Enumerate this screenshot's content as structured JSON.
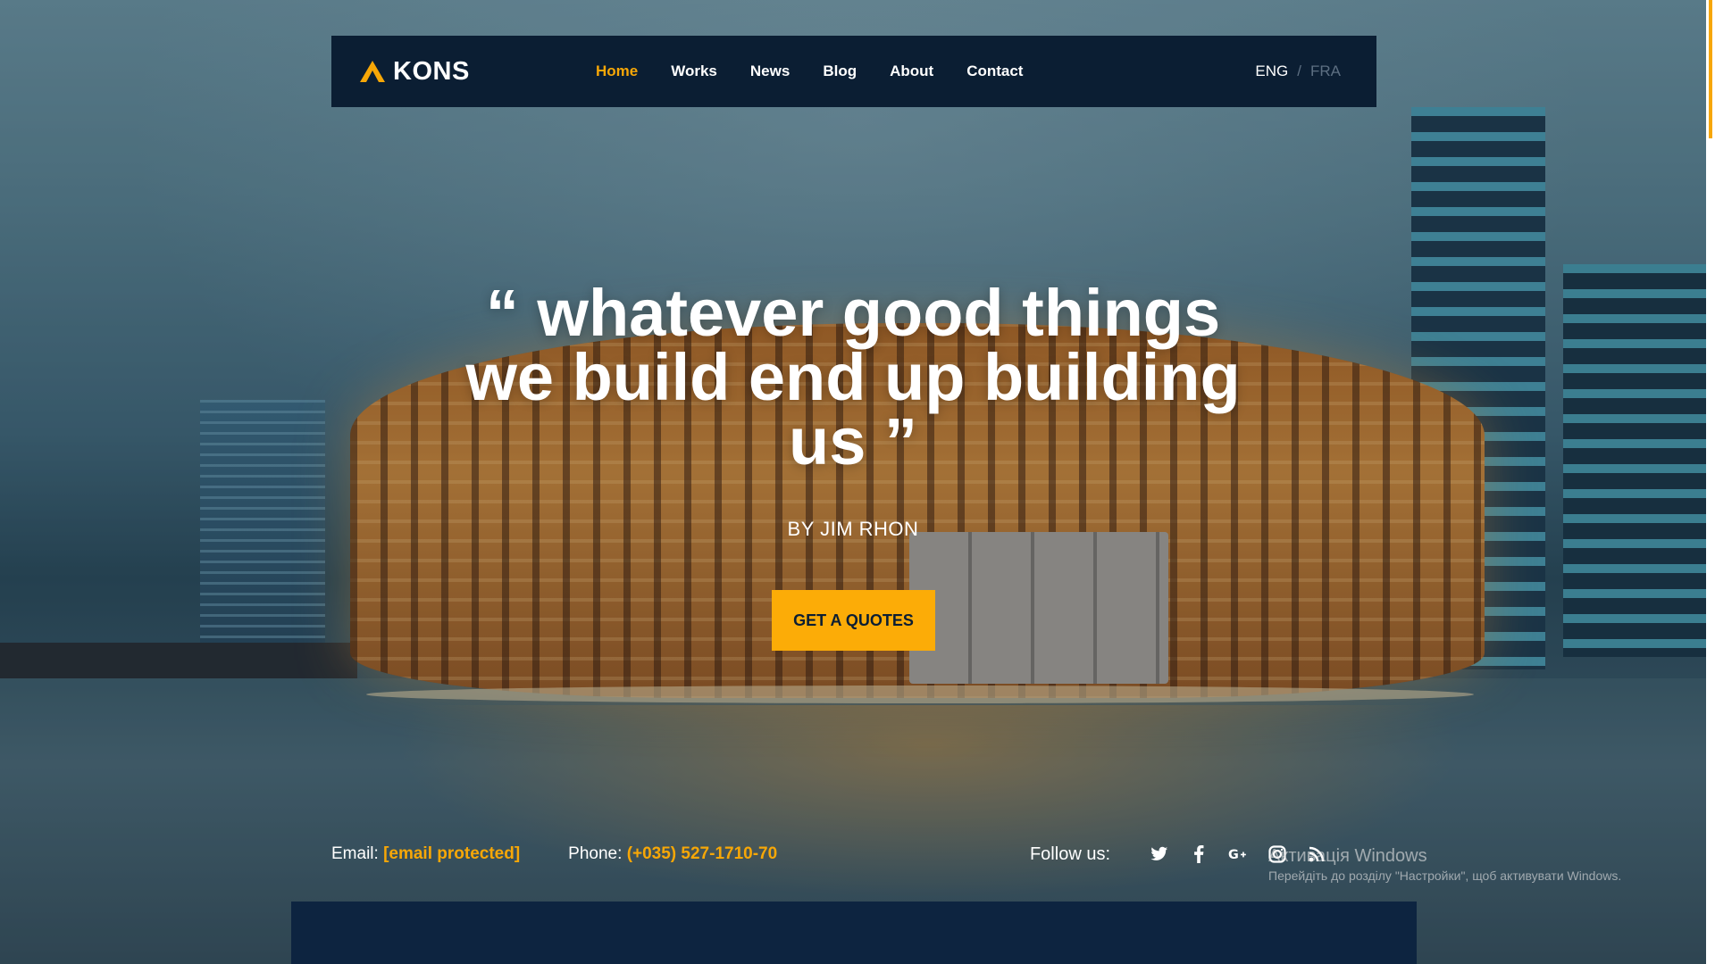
{
  "brand": {
    "name": "KONS",
    "accent_color": "#f7a707",
    "header_bg": "#0b1e33"
  },
  "nav": {
    "items": [
      {
        "label": "Home",
        "active": true
      },
      {
        "label": "Works",
        "active": false
      },
      {
        "label": "News",
        "active": false
      },
      {
        "label": "Blog",
        "active": false
      },
      {
        "label": "About",
        "active": false
      },
      {
        "label": "Contact",
        "active": false
      }
    ]
  },
  "lang": {
    "current": "ENG",
    "separator": "/",
    "other": "FRA"
  },
  "hero": {
    "quote": "“ whatever good things we build end up building us ”",
    "author": "BY JIM RHON",
    "cta_label": "GET A QUOTES"
  },
  "contact": {
    "email_label": "Email:",
    "email_value": "[email protected]",
    "phone_label": "Phone:",
    "phone_value": "(+035) 527-1710-70",
    "follow_label": "Follow us:",
    "social_icons": [
      "twitter-icon",
      "facebook-icon",
      "google-plus-icon",
      "instagram-icon",
      "rss-icon"
    ]
  },
  "watermark": {
    "title": "Активація Windows",
    "subtitle": "Перейдіть до розділу \"Настройки\", щоб активувати Windows."
  }
}
